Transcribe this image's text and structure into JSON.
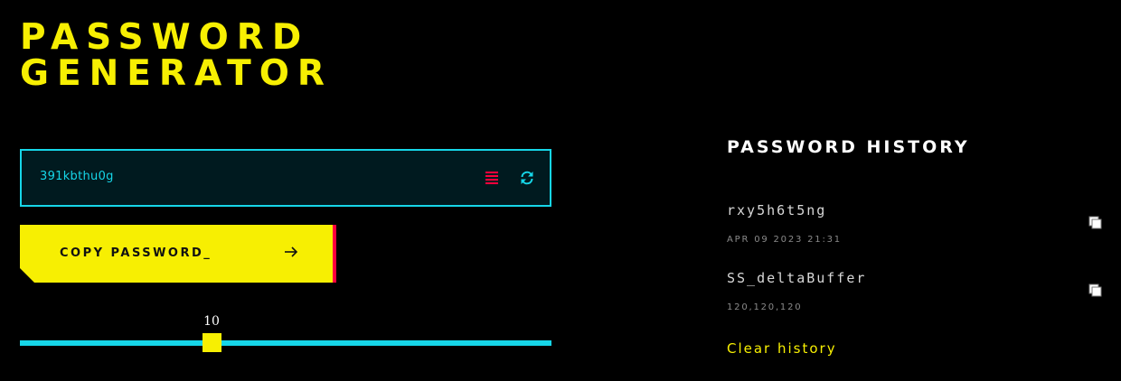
{
  "title": {
    "line1": "PASSWORD",
    "line2": "GENERATOR"
  },
  "generator": {
    "password": "391kbthu0g",
    "strength_icon": "strength-bars-icon",
    "refresh_icon": "refresh-icon",
    "copy_button_label": "COPY PASSWORD_",
    "copy_button_icon": "arrow-right-icon",
    "length": {
      "value": "10",
      "min": 1,
      "max": 26
    }
  },
  "history": {
    "title": "PASSWORD HISTORY",
    "items": [
      {
        "password": "rxy5h6t5ng",
        "meta": "APR 09 2023 21:31",
        "icon": "copy-icon"
      },
      {
        "password": "SS_deltaBuffer",
        "meta": "120,120,120",
        "icon": "copy-icon"
      }
    ],
    "clear_label": "Clear history"
  },
  "colors": {
    "background": "#000000",
    "accent_yellow": "#f7ef02",
    "accent_cyan": "#16d6e8",
    "accent_red": "#ff003c",
    "field_bg": "#001a1f"
  }
}
